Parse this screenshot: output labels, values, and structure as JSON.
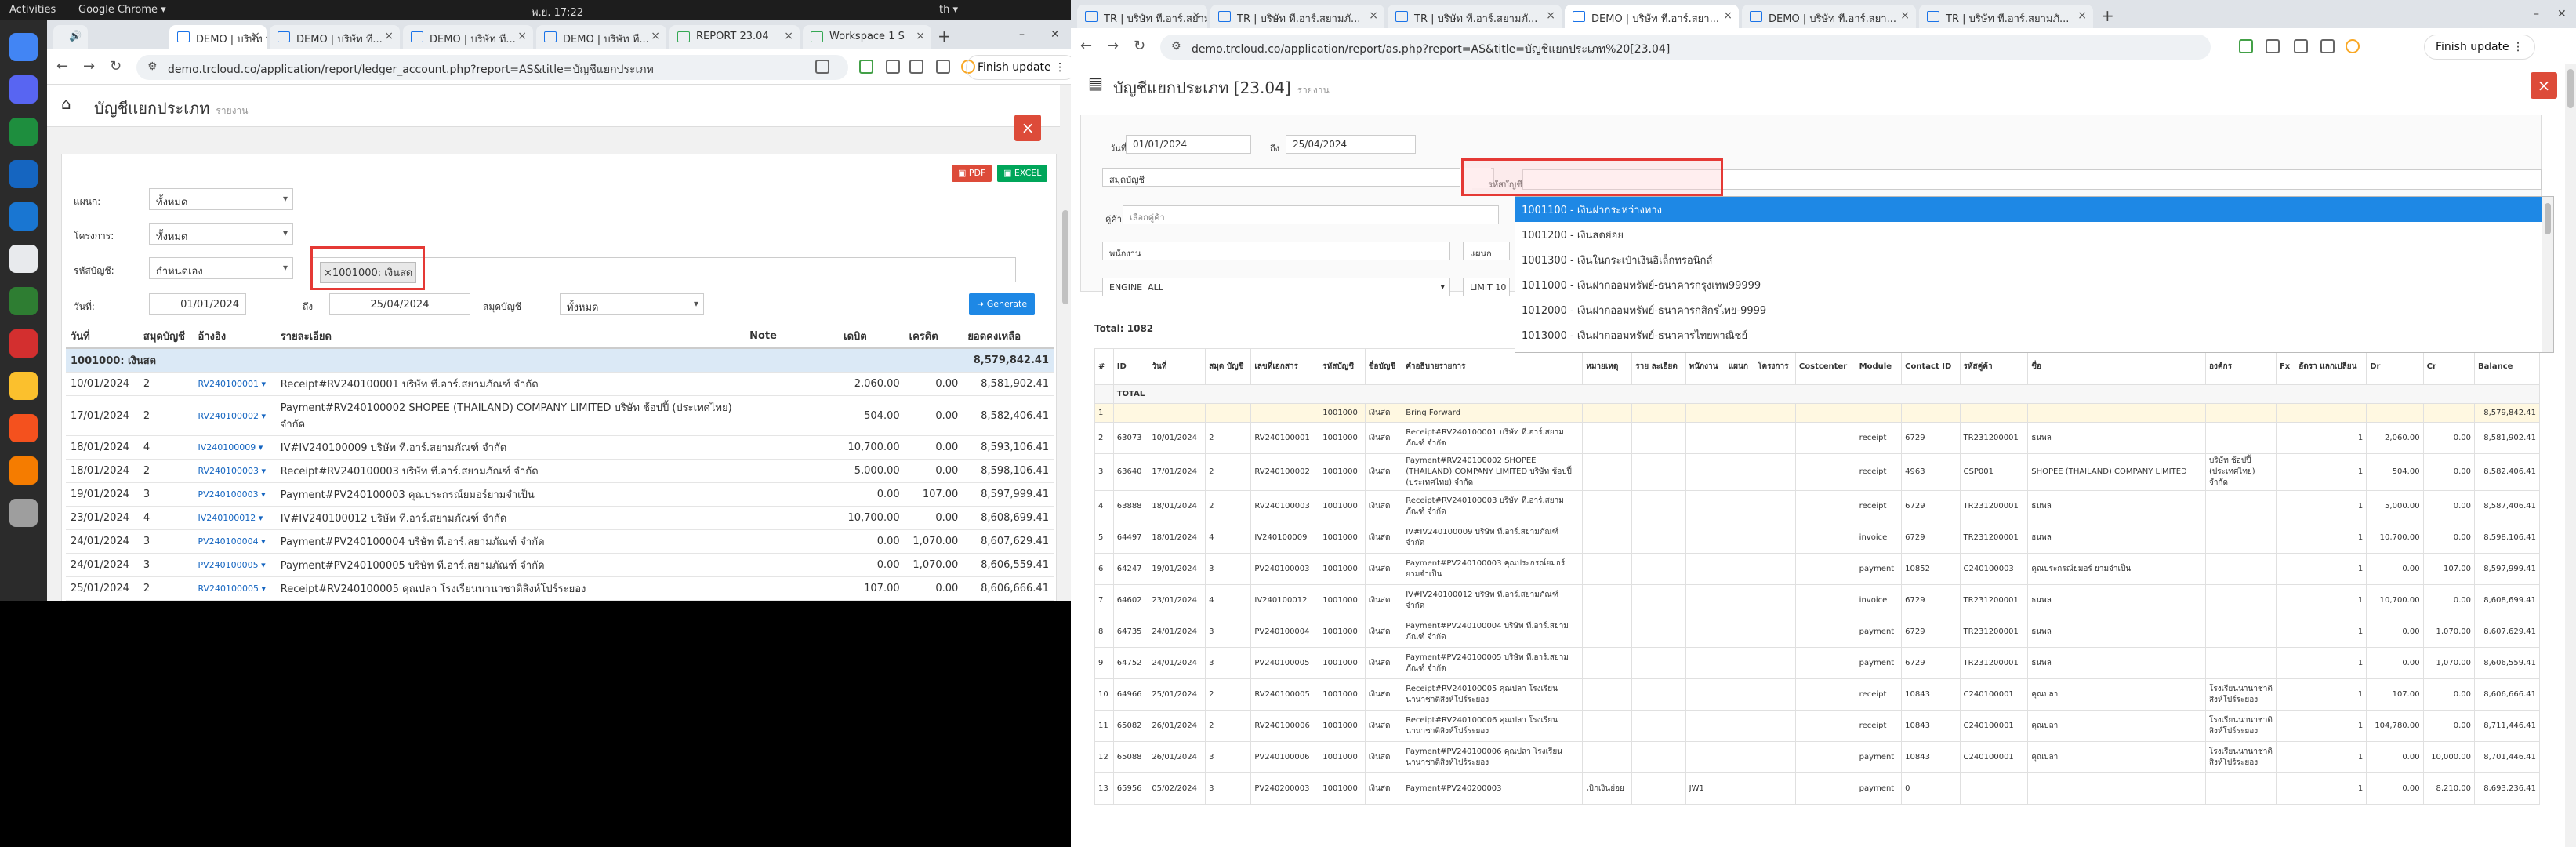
{
  "topbar": {
    "activities": "Activities",
    "app": "Google Chrome ▾",
    "clock": "พ.ย. 17:22",
    "lang": "th ▾"
  },
  "dock": {
    "colors": [
      "#4285f4",
      "#5865f2",
      "#1e8e3e",
      "#1565c0",
      "#1976d2",
      "#e8eaed",
      "#2e7d32",
      "#d32f2f",
      "#fbc02d",
      "#f4511e",
      "#f57c00",
      "#9e9e9e"
    ]
  },
  "left": {
    "tabs": [
      "",
      "DEMO | บริษัท ที...",
      "DEMO | บริษัท ที...",
      "DEMO | บริษัท ที...",
      "DEMO | บริษัท ที...",
      "REPORT 23.04",
      "Workspace 1 S"
    ],
    "url": "demo.trcloud.co/application/report/ledger_account.php?report=AS&title=บัญชีแยกประเภท",
    "finish": "Finish update",
    "title": "บัญชีแยกประเภท",
    "subtitle": "รายงาน",
    "pdf": "PDF",
    "excel": "EXCEL",
    "filters": {
      "dept_label": "แผนก:",
      "dept_value": "ทั้งหมด",
      "project_label": "โครงการ:",
      "project_value": "ทั้งหมด",
      "account_label": "รหัสบัญชี:",
      "account_mode": "กำหนดเอง",
      "account_chip": "×1001000: เงินสด",
      "date_label": "วันที่:",
      "date_from": "01/01/2024",
      "to": "ถึง",
      "date_to": "25/04/2024",
      "journal_label": "สมุดบัญชี",
      "journal_value": "ทั้งหมด",
      "generate": "Generate"
    },
    "columns": [
      "วันที่",
      "สมุดบัญชี",
      "อ้างอิง",
      "รายละเอียด",
      "Note",
      "เดบิต",
      "เครดิต",
      "ยอดคงเหลือ"
    ],
    "group": {
      "name": "1001000: เงินสด",
      "balance": "8,579,842.41"
    },
    "rows": [
      {
        "date": "10/01/2024",
        "book": "2",
        "ref": "RV240100001",
        "desc": "Receipt#RV240100001 บริษัท ที.อาร์.สยามภัณฑ์ จำกัด",
        "debit": "2,060.00",
        "credit": "0.00",
        "bal": "8,581,902.41"
      },
      {
        "date": "17/01/2024",
        "book": "2",
        "ref": "RV240100002",
        "desc": "Payment#RV240100002 SHOPEE (THAILAND) COMPANY LIMITED บริษัท ช้อปปี้ (ประเทศไทย) จำกัด",
        "debit": "504.00",
        "credit": "0.00",
        "bal": "8,582,406.41"
      },
      {
        "date": "18/01/2024",
        "book": "4",
        "ref": "IV240100009",
        "desc": "IV#IV240100009 บริษัท ที.อาร์.สยามภัณฑ์ จำกัด",
        "debit": "10,700.00",
        "credit": "0.00",
        "bal": "8,593,106.41"
      },
      {
        "date": "18/01/2024",
        "book": "2",
        "ref": "RV240100003",
        "desc": "Receipt#RV240100003 บริษัท ที.อาร์.สยามภัณฑ์ จำกัด",
        "debit": "5,000.00",
        "credit": "0.00",
        "bal": "8,598,106.41"
      },
      {
        "date": "19/01/2024",
        "book": "3",
        "ref": "PV240100003",
        "desc": "Payment#PV240100003 คุณประกรณ์ยมอร์ยามจำเป็น",
        "debit": "0.00",
        "credit": "107.00",
        "bal": "8,597,999.41"
      },
      {
        "date": "23/01/2024",
        "book": "4",
        "ref": "IV240100012",
        "desc": "IV#IV240100012 บริษัท ที.อาร์.สยามภัณฑ์ จำกัด",
        "debit": "10,700.00",
        "credit": "0.00",
        "bal": "8,608,699.41"
      },
      {
        "date": "24/01/2024",
        "book": "3",
        "ref": "PV240100004",
        "desc": "Payment#PV240100004 บริษัท ที.อาร์.สยามภัณฑ์ จำกัด",
        "debit": "0.00",
        "credit": "1,070.00",
        "bal": "8,607,629.41"
      },
      {
        "date": "24/01/2024",
        "book": "3",
        "ref": "PV240100005",
        "desc": "Payment#PV240100005 บริษัท ที.อาร์.สยามภัณฑ์ จำกัด",
        "debit": "0.00",
        "credit": "1,070.00",
        "bal": "8,606,559.41"
      },
      {
        "date": "25/01/2024",
        "book": "2",
        "ref": "RV240100005",
        "desc": "Receipt#RV240100005 คุณปลา โรงเรียนนานาชาติสิงห์โปร์ระยอง",
        "debit": "107.00",
        "credit": "0.00",
        "bal": "8,606,666.41"
      }
    ]
  },
  "right": {
    "tabs": [
      "TR | บริษัท ที.อาร์.สยามภั...",
      "TR | บริษัท ที.อาร์.สยามภั...",
      "TR | บริษัท ที.อาร์.สยามภั...",
      "DEMO | บริษัท ที.อาร์.สยา...",
      "DEMO | บริษัท ที.อาร์.สยา...",
      "TR | บริษัท ที.อาร์.สยามภั..."
    ],
    "url": "demo.trcloud.co/application/report/as.php?report=AS&title=บัญชีแยกประเภท%20[23.04]",
    "finish": "Finish update",
    "title": "บัญชีแยกประเภท [23.04]",
    "subtitle": "รายงาน",
    "filters": {
      "date_label": "วันที่",
      "date_from": "01/01/2024",
      "to": "ถึง",
      "date_to": "25/04/2024",
      "journal_label": "สมุดบัญชี",
      "account_label": "รหัสบัญชี",
      "customer_label": "คู่ค้า",
      "customer_placeholder": "เลือกคู่ค้า",
      "employee_label": "พนักงาน",
      "dept_label": "แผนก",
      "engine_label": "ENGINE",
      "engine_value": "ALL",
      "limit_label": "LIMIT",
      "limit_value": "10"
    },
    "dropdown": [
      "1001100 - เงินฝากระหว่างทาง",
      "1001200 - เงินสดย่อย",
      "1001300 - เงินในกระเป๋าเงินอิเล็กทรอนิกส์",
      "1011000 - เงินฝากออมทรัพย์-ธนาคารกรุงเทพ99999",
      "1012000 - เงินฝากออมทรัพย์-ธนาคารกสิกรไทย-9999",
      "1013000 - เงินฝากออมทรัพย์-ธนาคารไทยพาณิชย์"
    ],
    "total_label": "Total: 1082",
    "columns": [
      "#",
      "ID",
      "วันที่",
      "สมุด บัญชี",
      "เลขที่เอกสาร",
      "รหัสบัญชี",
      "ชื่อบัญชี",
      "คำอธิบายรายการ",
      "หมายเหตุ",
      "ราย ละเอียด",
      "พนักงาน",
      "แผนก",
      "โครงการ",
      "Costcenter",
      "Module",
      "Contact ID",
      "รหัสคู่ค้า",
      "ชื่อ",
      "องค์กร",
      "Fx",
      "อัตรา แลกเปลี่ยน",
      "Dr",
      "Cr",
      "Balance"
    ],
    "total_row": "TOTAL",
    "bf": {
      "n": "1",
      "code": "1001000",
      "name": "เงินสด",
      "desc": "Bring Forward",
      "bal": "8,579,842.41"
    },
    "rows": [
      {
        "n": "2",
        "id": "63073",
        "date": "10/01/2024",
        "book": "2",
        "doc": "RV240100001",
        "code": "1001000",
        "name": "เงินสด",
        "desc": "Receipt#RV240100001 บริษัท ที.อาร์.สยามภัณฑ์ จำกัด",
        "module": "receipt",
        "cid": "6729",
        "ccode": "TR231200001",
        "cname": "ธนพล",
        "org": "",
        "rate": "1",
        "dr": "2,060.00",
        "cr": "0.00",
        "bal": "8,581,902.41"
      },
      {
        "n": "3",
        "id": "63640",
        "date": "17/01/2024",
        "book": "2",
        "doc": "RV240100002",
        "code": "1001000",
        "name": "เงินสด",
        "desc": "Payment#RV240100002 SHOPEE (THAILAND) COMPANY LIMITED บริษัท ช้อปปี้ (ประเทศไทย) จำกัด",
        "module": "receipt",
        "cid": "4963",
        "ccode": "CSP001",
        "cname": "SHOPEE (THAILAND) COMPANY LIMITED",
        "org": "บริษัท ช้อปปี้ (ประเทศไทย) จำกัด",
        "rate": "1",
        "dr": "504.00",
        "cr": "0.00",
        "bal": "8,582,406.41"
      },
      {
        "n": "4",
        "id": "63888",
        "date": "18/01/2024",
        "book": "2",
        "doc": "RV240100003",
        "code": "1001000",
        "name": "เงินสด",
        "desc": "Receipt#RV240100003 บริษัท ที.อาร์.สยาม ภัณฑ์ จำกัด",
        "module": "receipt",
        "cid": "6729",
        "ccode": "TR231200001",
        "cname": "ธนพล",
        "org": "",
        "rate": "1",
        "dr": "5,000.00",
        "cr": "0.00",
        "bal": "8,587,406.41"
      },
      {
        "n": "5",
        "id": "64497",
        "date": "18/01/2024",
        "book": "4",
        "doc": "IV240100009",
        "code": "1001000",
        "name": "เงินสด",
        "desc": "IV#IV240100009 บริษัท ที.อาร์.สยามภัณฑ์ จำกัด",
        "module": "invoice",
        "cid": "6729",
        "ccode": "TR231200001",
        "cname": "ธนพล",
        "org": "",
        "rate": "1",
        "dr": "10,700.00",
        "cr": "0.00",
        "bal": "8,598,106.41"
      },
      {
        "n": "6",
        "id": "64247",
        "date": "19/01/2024",
        "book": "3",
        "doc": "PV240100003",
        "code": "1001000",
        "name": "เงินสด",
        "desc": "Payment#PV240100003 คุณประกรณ์ยมอร์ ยามจำเป็น",
        "module": "payment",
        "cid": "10852",
        "ccode": "C240100003",
        "cname": "คุณประกรณ์ยมอร์ ยามจำเป็น",
        "org": "",
        "rate": "1",
        "dr": "0.00",
        "cr": "107.00",
        "bal": "8,597,999.41"
      },
      {
        "n": "7",
        "id": "64602",
        "date": "23/01/2024",
        "book": "4",
        "doc": "IV240100012",
        "code": "1001000",
        "name": "เงินสด",
        "desc": "IV#IV240100012 บริษัท ที.อาร์.สยามภัณฑ์ จำกัด",
        "module": "invoice",
        "cid": "6729",
        "ccode": "TR231200001",
        "cname": "ธนพล",
        "org": "",
        "rate": "1",
        "dr": "10,700.00",
        "cr": "0.00",
        "bal": "8,608,699.41"
      },
      {
        "n": "8",
        "id": "64735",
        "date": "24/01/2024",
        "book": "3",
        "doc": "PV240100004",
        "code": "1001000",
        "name": "เงินสด",
        "desc": "Payment#PV240100004 บริษัท ที.อาร์.สยาม ภัณฑ์ จำกัด",
        "module": "payment",
        "cid": "6729",
        "ccode": "TR231200001",
        "cname": "ธนพล",
        "org": "",
        "rate": "1",
        "dr": "0.00",
        "cr": "1,070.00",
        "bal": "8,607,629.41"
      },
      {
        "n": "9",
        "id": "64752",
        "date": "24/01/2024",
        "book": "3",
        "doc": "PV240100005",
        "code": "1001000",
        "name": "เงินสด",
        "desc": "Payment#PV240100005 บริษัท ที.อาร์.สยาม ภัณฑ์ จำกัด",
        "module": "payment",
        "cid": "6729",
        "ccode": "TR231200001",
        "cname": "ธนพล",
        "org": "",
        "rate": "1",
        "dr": "0.00",
        "cr": "1,070.00",
        "bal": "8,606,559.41"
      },
      {
        "n": "10",
        "id": "64966",
        "date": "25/01/2024",
        "book": "2",
        "doc": "RV240100005",
        "code": "1001000",
        "name": "เงินสด",
        "desc": "Receipt#RV240100005 คุณปลา โรงเรียน นานาชาติสิงห์โปร์ระยอง",
        "module": "receipt",
        "cid": "10843",
        "ccode": "C240100001",
        "cname": "คุณปลา",
        "org": "โรงเรียนนานาชาติ สิงห์โปร์ระยอง",
        "rate": "1",
        "dr": "107.00",
        "cr": "0.00",
        "bal": "8,606,666.41"
      },
      {
        "n": "11",
        "id": "65082",
        "date": "26/01/2024",
        "book": "2",
        "doc": "RV240100006",
        "code": "1001000",
        "name": "เงินสด",
        "desc": "Receipt#RV240100006 คุณปลา โรงเรียน นานาชาติสิงห์โปร์ระยอง",
        "module": "receipt",
        "cid": "10843",
        "ccode": "C240100001",
        "cname": "คุณปลา",
        "org": "โรงเรียนนานาชาติ สิงห์โปร์ระยอง",
        "rate": "1",
        "dr": "104,780.00",
        "cr": "0.00",
        "bal": "8,711,446.41"
      },
      {
        "n": "12",
        "id": "65088",
        "date": "26/01/2024",
        "book": "3",
        "doc": "PV240100006",
        "code": "1001000",
        "name": "เงินสด",
        "desc": "Payment#PV240100006 คุณปลา โรงเรียน นานาชาติสิงห์โปร์ระยอง",
        "module": "payment",
        "cid": "10843",
        "ccode": "C240100001",
        "cname": "คุณปลา",
        "org": "โรงเรียนนานาชาติ สิงห์โปร์ระยอง",
        "rate": "1",
        "dr": "0.00",
        "cr": "10,000.00",
        "bal": "8,701,446.41"
      },
      {
        "n": "13",
        "id": "65956",
        "date": "05/02/2024",
        "book": "3",
        "doc": "PV240200003",
        "code": "1001000",
        "name": "เงินสด",
        "desc": "Payment#PV240200003",
        "note": "เบิกเงินย่อย",
        "emp": "JW1",
        "module": "payment",
        "cid": "0",
        "ccode": "",
        "cname": "",
        "org": "",
        "rate": "1",
        "dr": "0.00",
        "cr": "8,210.00",
        "bal": "8,693,236.41"
      }
    ]
  }
}
